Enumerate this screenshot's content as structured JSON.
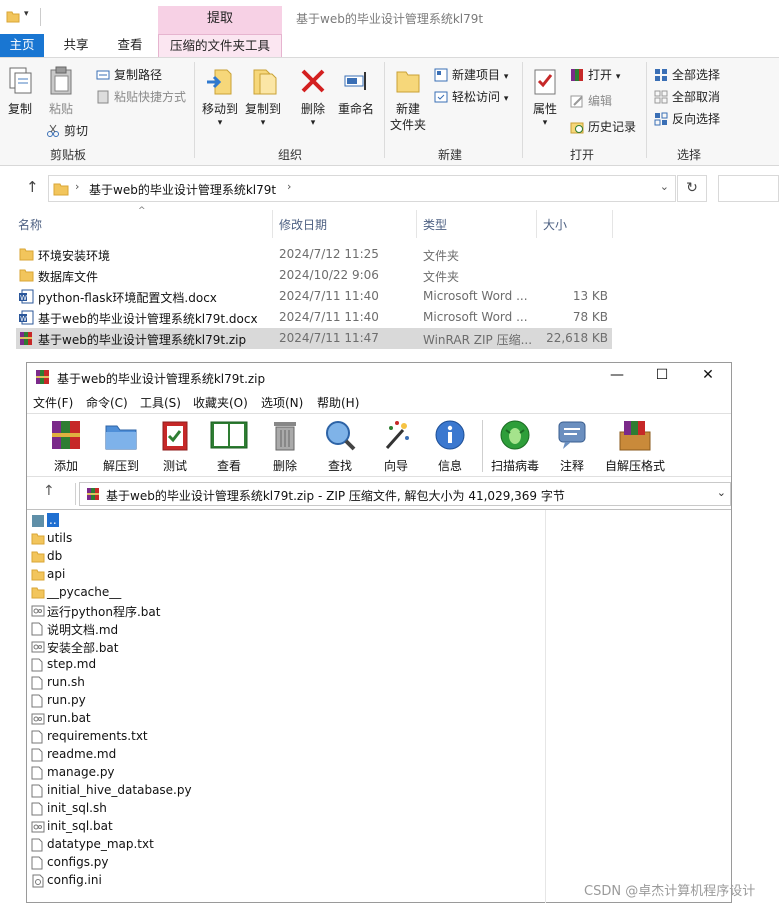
{
  "explorer": {
    "title": "基于web的毕业设计管理系统kl79t",
    "context_tab_header": "提取",
    "tabs": [
      "主页",
      "共享",
      "查看",
      "压缩的文件夹工具"
    ],
    "ribbon": {
      "clipboard": {
        "label": "剪贴板",
        "copy": "复制",
        "paste": "粘贴",
        "copy_path": "复制路径",
        "paste_shortcut": "粘贴快捷方式",
        "cut": "剪切"
      },
      "organize": {
        "label": "组织",
        "move_to": "移动到",
        "copy_to": "复制到",
        "delete": "删除",
        "rename": "重命名"
      },
      "new": {
        "label": "新建",
        "new_folder_line1": "新建",
        "new_folder_line2": "文件夹",
        "new_item": "新建项目",
        "easy_access": "轻松访问"
      },
      "open": {
        "label": "打开",
        "properties": "属性",
        "open": "打开",
        "edit": "编辑",
        "history": "历史记录"
      },
      "select": {
        "label": "选择",
        "select_all": "全部选择",
        "select_none": "全部取消",
        "invert": "反向选择"
      }
    },
    "address": {
      "crumb": "基于web的毕业设计管理系统kl79t"
    },
    "columns": {
      "name": "名称",
      "date": "修改日期",
      "type": "类型",
      "size": "大小"
    },
    "files": [
      {
        "name": "环境安装环境",
        "date": "2024/7/12 11:25",
        "type": "文件夹",
        "size": ""
      },
      {
        "name": "数据库文件",
        "date": "2024/10/22 9:06",
        "type": "文件夹",
        "size": ""
      },
      {
        "name": "python-flask环境配置文档.docx",
        "date": "2024/7/11 11:40",
        "type": "Microsoft Word ...",
        "size": "13 KB"
      },
      {
        "name": "基于web的毕业设计管理系统kl79t.docx",
        "date": "2024/7/11 11:40",
        "type": "Microsoft Word ...",
        "size": "78 KB"
      },
      {
        "name": "基于web的毕业设计管理系统kl79t.zip",
        "date": "2024/7/11 11:47",
        "type": "WinRAR ZIP 压缩...",
        "size": "22,618 KB"
      }
    ]
  },
  "winrar": {
    "title": "基于web的毕业设计管理系统kl79t.zip",
    "menu": [
      "文件(F)",
      "命令(C)",
      "工具(S)",
      "收藏夹(O)",
      "选项(N)",
      "帮助(H)"
    ],
    "toolbar": [
      "添加",
      "解压到",
      "测试",
      "查看",
      "删除",
      "查找",
      "向导",
      "信息",
      "扫描病毒",
      "注释",
      "自解压格式"
    ],
    "path_text": "基于web的毕业设计管理系统kl79t.zip - ZIP 压缩文件, 解包大小为 41,029,369 字节",
    "items": [
      {
        "name": "..",
        "kind": "up"
      },
      {
        "name": "utils",
        "kind": "folder"
      },
      {
        "name": "db",
        "kind": "folder"
      },
      {
        "name": "api",
        "kind": "folder"
      },
      {
        "name": "__pycache__",
        "kind": "folder"
      },
      {
        "name": "运行python程序.bat",
        "kind": "bat"
      },
      {
        "name": "说明文档.md",
        "kind": "file"
      },
      {
        "name": "安装全部.bat",
        "kind": "bat"
      },
      {
        "name": "step.md",
        "kind": "file"
      },
      {
        "name": "run.sh",
        "kind": "file"
      },
      {
        "name": "run.py",
        "kind": "file"
      },
      {
        "name": "run.bat",
        "kind": "bat"
      },
      {
        "name": "requirements.txt",
        "kind": "file"
      },
      {
        "name": "readme.md",
        "kind": "file"
      },
      {
        "name": "manage.py",
        "kind": "file"
      },
      {
        "name": "initial_hive_database.py",
        "kind": "file"
      },
      {
        "name": "init_sql.sh",
        "kind": "file"
      },
      {
        "name": "init_sql.bat",
        "kind": "bat"
      },
      {
        "name": "datatype_map.txt",
        "kind": "file"
      },
      {
        "name": "configs.py",
        "kind": "file"
      },
      {
        "name": "config.ini",
        "kind": "ini"
      }
    ]
  },
  "watermark": "CSDN @卓杰计算机程序设计"
}
